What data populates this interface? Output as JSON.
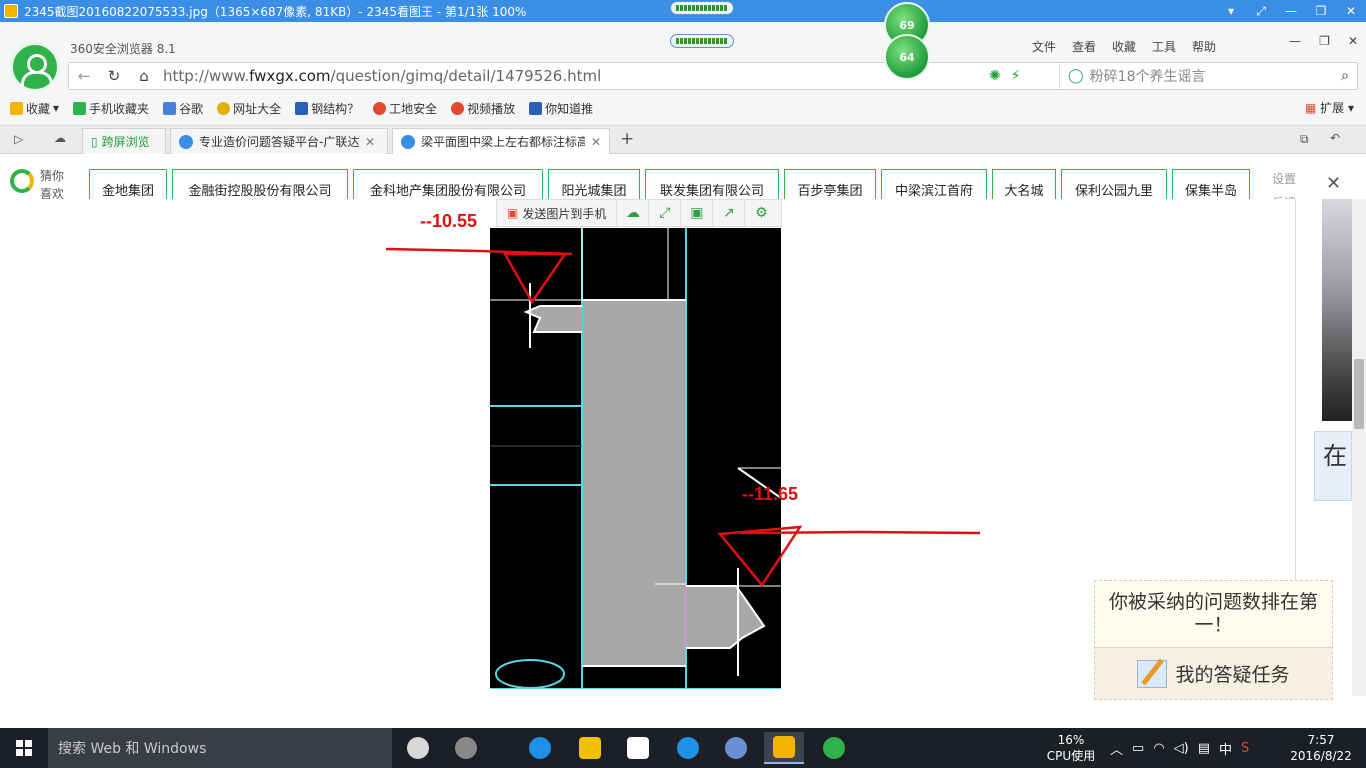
{
  "viewer": {
    "title": "2345截图20160822075533.jpg（1365×687像素, 81KB）- 2345看图王 - 第1/1张 100%",
    "controls": [
      "▾",
      "⤢",
      "—",
      "❐",
      "✕"
    ]
  },
  "overlays": {
    "ball_top": "69",
    "ball_bottom": "64"
  },
  "browser": {
    "brand": "360安全浏览器 8.1",
    "menu": [
      "文件",
      "查看",
      "收藏",
      "工具",
      "帮助"
    ],
    "url_prefix": "http://www.",
    "url_domain": "fwxgx.com",
    "url_path": "/question/gimq/detail/1479526.html",
    "search_placeholder": "粉碎18个养生谣言",
    "favorites": [
      {
        "label": "收藏",
        "color": "#f2b400"
      },
      {
        "label": "手机收藏夹",
        "color": "#2fb24a"
      },
      {
        "label": "谷歌",
        "color": "#4a7fd6"
      },
      {
        "label": "网址大全",
        "color": "#e2b200"
      },
      {
        "label": "钢结构？",
        "color": "#2b5fb8"
      },
      {
        "label": "工地安全",
        "color": "#e2492f"
      },
      {
        "label": "视频播放",
        "color": "#e2492f"
      },
      {
        "label": "你知道推",
        "color": "#2b5fb8"
      }
    ],
    "extensions_label": "扩展",
    "tabs": [
      {
        "label": "跨屏浏览"
      },
      {
        "label": "专业造价问题答疑平台-广联达"
      },
      {
        "label": "梁平面图中梁上左右都标注标高"
      }
    ],
    "new_tab": "+"
  },
  "recommend": {
    "label": "猜你喜欢",
    "chips": [
      "金地集团",
      "金融街控股股份有限公司",
      "金科地产集团股份有限公司",
      "阳光城集团",
      "联发集团有限公司",
      "百步亭集团",
      "中梁滨江首府",
      "大名城",
      "保利公园九里",
      "保集半岛"
    ],
    "settings": "设置",
    "feedback": "反馈"
  },
  "image_toolbar": {
    "send_label": "发送图片到手机"
  },
  "annotations": {
    "elev_top": "--10.55",
    "elev_bottom": "--11.65"
  },
  "side_card_text": "在",
  "popup": {
    "message": "你被采纳的问题数排在第一！",
    "task_label": "我的答疑任务"
  },
  "taskbar": {
    "search_placeholder": "搜索 Web 和 Windows",
    "cpu_percent": "16%",
    "cpu_label": "CPU使用",
    "ime": "中",
    "time": "7:57",
    "date": "2016/8/22"
  }
}
